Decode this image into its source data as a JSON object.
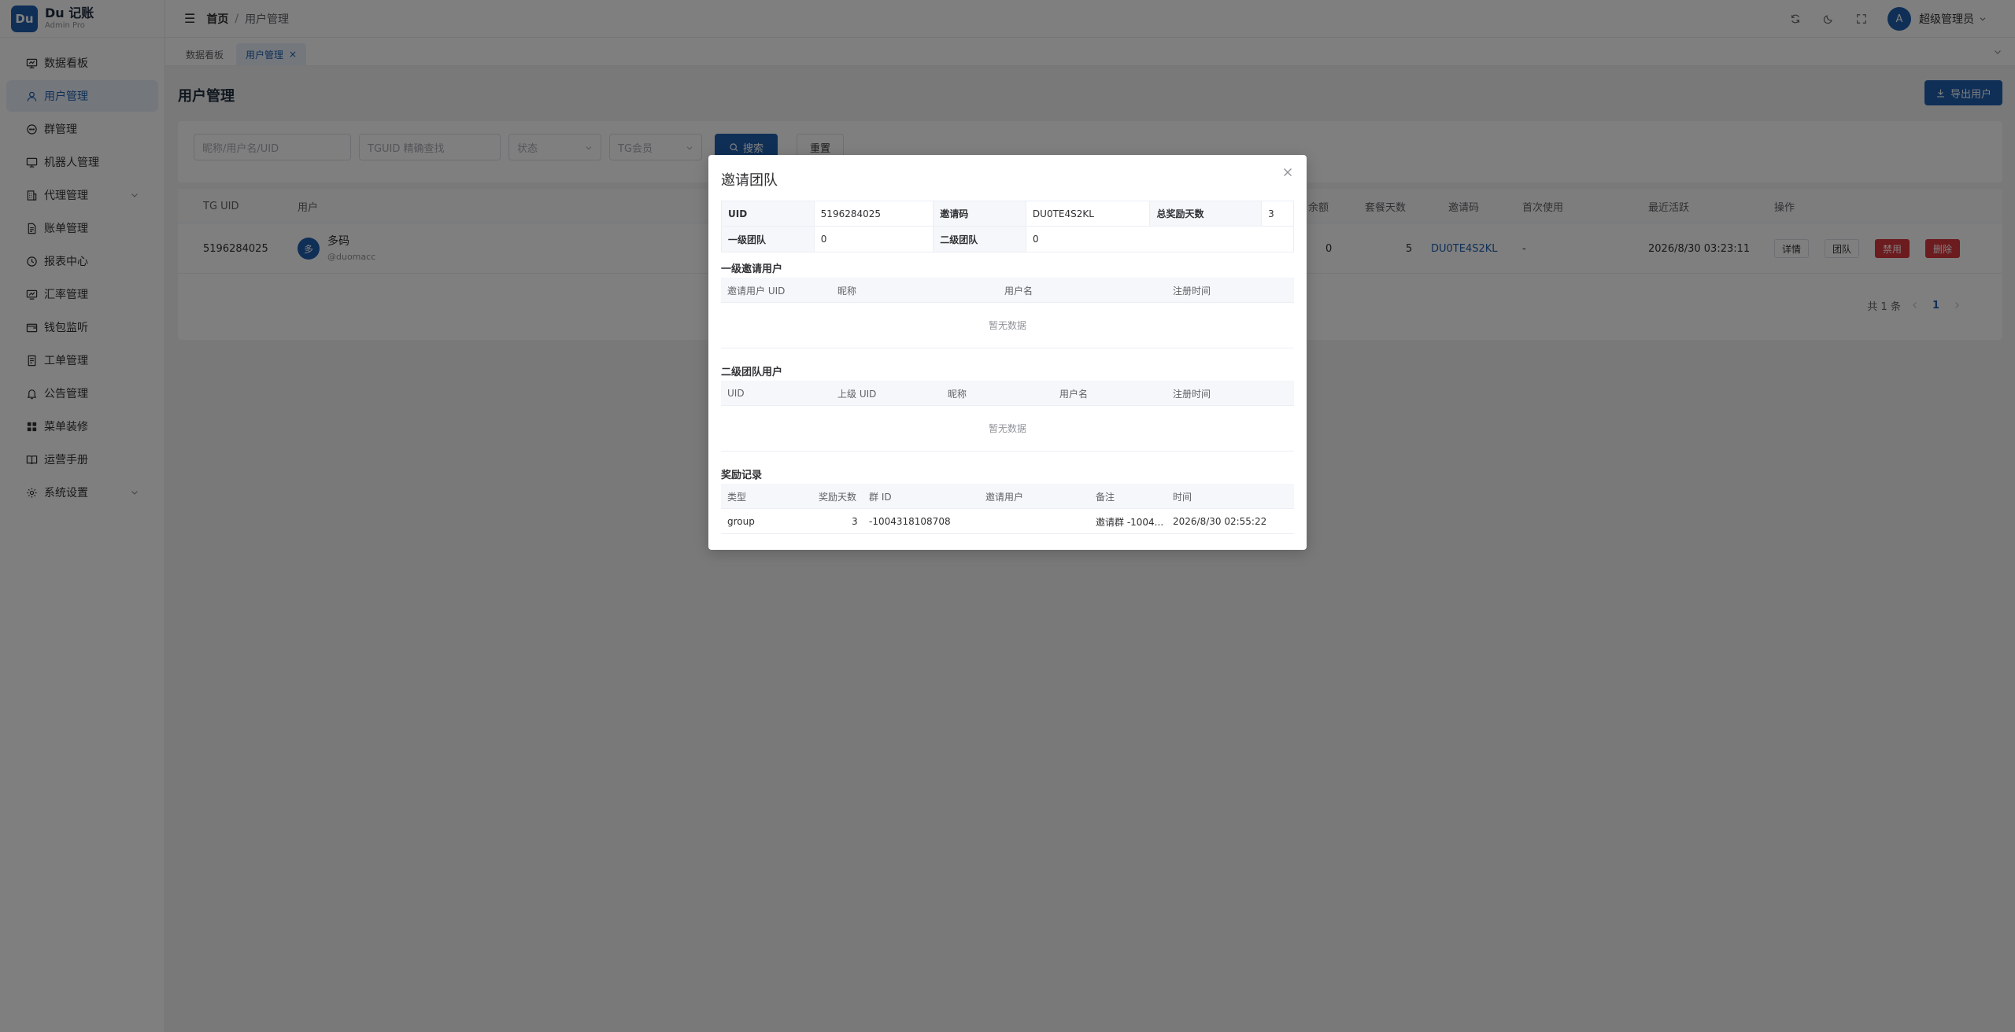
{
  "brand": {
    "logo": "Du",
    "title": "Du 记账",
    "subtitle": "Admin Pro"
  },
  "sidebar": {
    "items": [
      {
        "label": "数据看板",
        "icon": "dashboard-icon"
      },
      {
        "label": "用户管理",
        "icon": "user-icon",
        "active": true
      },
      {
        "label": "群管理",
        "icon": "chat-icon"
      },
      {
        "label": "机器人管理",
        "icon": "monitor-icon"
      },
      {
        "label": "代理管理",
        "icon": "building-icon",
        "expandable": true
      },
      {
        "label": "账单管理",
        "icon": "document-icon"
      },
      {
        "label": "报表中心",
        "icon": "clock-icon"
      },
      {
        "label": "汇率管理",
        "icon": "chart-icon"
      },
      {
        "label": "钱包监听",
        "icon": "wallet-icon"
      },
      {
        "label": "工单管理",
        "icon": "ticket-icon"
      },
      {
        "label": "公告管理",
        "icon": "bell-icon"
      },
      {
        "label": "菜单装修",
        "icon": "grid-icon"
      },
      {
        "label": "运营手册",
        "icon": "book-icon"
      },
      {
        "label": "系统设置",
        "icon": "gear-icon",
        "expandable": true
      }
    ]
  },
  "header": {
    "breadcrumb_home": "首页",
    "breadcrumb_sep": "/",
    "breadcrumb_current": "用户管理",
    "avatar_letter": "A",
    "user_name": "超级管理员"
  },
  "tabs": [
    {
      "label": "数据看板"
    },
    {
      "label": "用户管理",
      "active": true,
      "close": "×"
    }
  ],
  "page": {
    "title": "用户管理",
    "export_label": "导出用户"
  },
  "filters": {
    "keyword_placeholder": "昵称/用户名/UID",
    "tguid_placeholder": "TGUID 精确查找",
    "status_placeholder": "状态",
    "tg_member_placeholder": "TG会员",
    "search_label": "搜索",
    "reset_label": "重置"
  },
  "user_table": {
    "headers": {
      "tg_uid": "TG UID",
      "user": "用户",
      "balance": "余额",
      "package_days": "套餐天数",
      "invite_code": "邀请码",
      "first_use": "首次使用",
      "last_active": "最近活跃",
      "actions": "操作"
    },
    "row": {
      "tg_uid": "5196284025",
      "avatar_char": "多",
      "name": "多码",
      "handle": "@duomacc",
      "balance": "0",
      "package_days": "5",
      "invite_code": "DU0TE4S2KL",
      "first_use": "-",
      "last_active": "2026/8/30 03:23:11",
      "btn_detail": "详情",
      "btn_team": "团队",
      "btn_disable": "禁用",
      "btn_delete": "删除"
    },
    "pager": {
      "total": "共 1 条",
      "current": "1"
    }
  },
  "modal": {
    "title": "邀请团队",
    "desc": {
      "uid_label": "UID",
      "uid_value": "5196284025",
      "code_label": "邀请码",
      "code_value": "DU0TE4S2KL",
      "days_label": "总奖励天数",
      "days_value": "3",
      "lvl1_label": "一级团队",
      "lvl1_value": "0",
      "lvl2_label": "二级团队",
      "lvl2_value": "0"
    },
    "level1": {
      "title": "一级邀请用户",
      "headers": {
        "uid": "邀请用户 UID",
        "nick": "昵称",
        "username": "用户名",
        "time": "注册时间"
      },
      "empty": "暂无数据"
    },
    "level2": {
      "title": "二级团队用户",
      "headers": {
        "uid": "UID",
        "parent": "上级 UID",
        "nick": "昵称",
        "username": "用户名",
        "time": "注册时间"
      },
      "empty": "暂无数据"
    },
    "rewards": {
      "title": "奖励记录",
      "headers": {
        "type": "类型",
        "days": "奖励天数",
        "group_id": "群 ID",
        "inviter": "邀请用户",
        "note": "备注",
        "time": "时间"
      },
      "row": {
        "type": "group",
        "days": "3",
        "group_id": "-1004318108708",
        "inviter": "",
        "note": "邀请群 -1004...",
        "time": "2026/8/30 02:55:22"
      }
    }
  },
  "colors": {
    "primary": "#1f5fae",
    "danger": "#d9363e",
    "overlay": "rgba(0,0,0,0.5)"
  }
}
